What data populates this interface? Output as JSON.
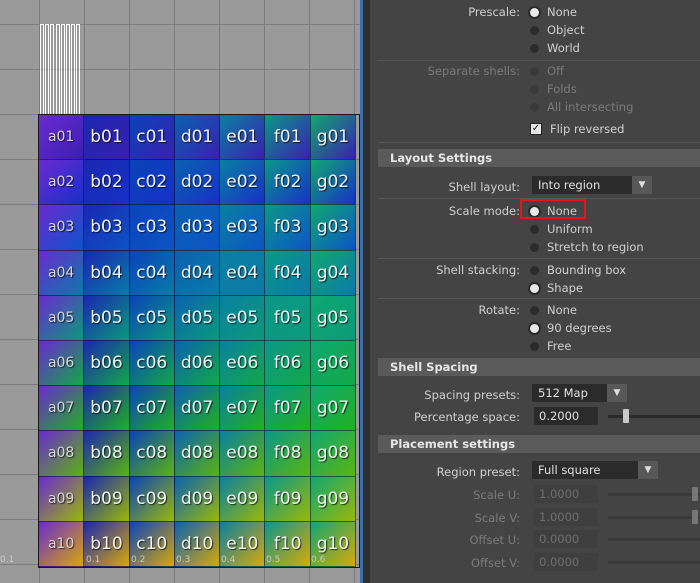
{
  "uv_editor": {
    "rows": [
      [
        "a01",
        "b01",
        "c01",
        "d01",
        "e01",
        "f01",
        "g01"
      ],
      [
        "a02",
        "b02",
        "c02",
        "d02",
        "e02",
        "f02",
        "g02"
      ],
      [
        "a03",
        "b03",
        "c03",
        "d03",
        "e03",
        "f03",
        "g03"
      ],
      [
        "a04",
        "b04",
        "c04",
        "d04",
        "e04",
        "f04",
        "g04"
      ],
      [
        "a05",
        "b05",
        "c05",
        "d05",
        "e05",
        "f05",
        "g05"
      ],
      [
        "a06",
        "b06",
        "c06",
        "d06",
        "e06",
        "f06",
        "g06"
      ],
      [
        "a07",
        "b07",
        "c07",
        "d07",
        "e07",
        "f07",
        "g07"
      ],
      [
        "a08",
        "b08",
        "c08",
        "d08",
        "e08",
        "f08",
        "g08"
      ],
      [
        "a09",
        "b09",
        "c09",
        "d09",
        "e09",
        "f09",
        "g09"
      ],
      [
        "a10",
        "b10",
        "c10",
        "d10",
        "e10",
        "f10",
        "g10"
      ]
    ],
    "axis_ticks": [
      "0.1",
      "0.1",
      "0.2",
      "0.3",
      "0.4",
      "0.5",
      "0.6"
    ],
    "row_colors": [
      "#3a1fb0",
      "#1730c8",
      "#0c54c8",
      "#0a7aa8",
      "#0a9a7a",
      "#12a848",
      "#22b020",
      "#5ab410",
      "#9ab808",
      "#d8a808"
    ],
    "column_tints": [
      "#6a2ad0",
      "#1a28b0",
      "#0a44b8",
      "#0a62b0",
      "#0a80a0",
      "#0a9888",
      "#10a870"
    ]
  },
  "panel": {
    "prescale": {
      "label": "Prescale:",
      "options": [
        {
          "label": "None",
          "selected": true
        },
        {
          "label": "Object",
          "selected": false
        },
        {
          "label": "World",
          "selected": false
        }
      ]
    },
    "separate_shells": {
      "label": "Separate shells:",
      "options": [
        {
          "label": "Off",
          "selected": false
        },
        {
          "label": "Folds",
          "selected": false
        },
        {
          "label": "All intersecting",
          "selected": false
        }
      ]
    },
    "flip_reversed": {
      "label": "Flip reversed",
      "checked": true
    },
    "layout_settings": {
      "title": "Layout Settings",
      "shell_layout": {
        "label": "Shell layout:",
        "value": "Into region"
      },
      "scale_mode": {
        "label": "Scale mode:",
        "options": [
          {
            "label": "None",
            "selected": true
          },
          {
            "label": "Uniform",
            "selected": false
          },
          {
            "label": "Stretch to region",
            "selected": false
          }
        ]
      },
      "shell_stacking": {
        "label": "Shell stacking:",
        "options": [
          {
            "label": "Bounding box",
            "selected": false
          },
          {
            "label": "Shape",
            "selected": true
          }
        ]
      },
      "rotate": {
        "label": "Rotate:",
        "options": [
          {
            "label": "None",
            "selected": false
          },
          {
            "label": "90 degrees",
            "selected": true
          },
          {
            "label": "Free",
            "selected": false
          }
        ]
      }
    },
    "shell_spacing": {
      "title": "Shell Spacing",
      "spacing_presets": {
        "label": "Spacing presets:",
        "value": "512 Map"
      },
      "percentage_space": {
        "label": "Percentage space:",
        "value": "0.2000",
        "slider_fraction": 0.17
      }
    },
    "placement_settings": {
      "title": "Placement settings",
      "region_preset": {
        "label": "Region preset:",
        "value": "Full square"
      },
      "scale_u": {
        "label": "Scale U:",
        "value": "1.0000",
        "slider_fraction": 0.98
      },
      "scale_v": {
        "label": "Scale V:",
        "value": "1.0000",
        "slider_fraction": 0.98
      },
      "offset_u": {
        "label": "Offset U:",
        "value": "0.0000"
      },
      "offset_v": {
        "label": "Offset V:",
        "value": "0.0000"
      }
    },
    "icons": {
      "dropdown": "chevron-down-icon",
      "check": "checkmark-icon"
    },
    "highlight_color": "#e8141c"
  }
}
